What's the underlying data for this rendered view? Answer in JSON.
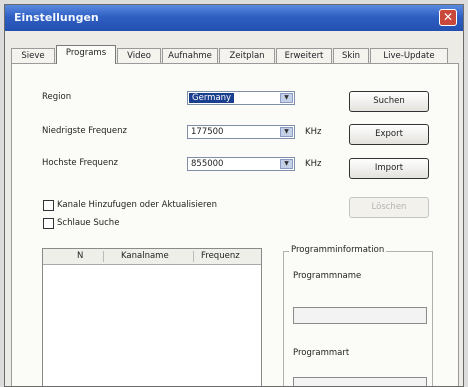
{
  "window": {
    "title": "Einstellungen"
  },
  "tabs": [
    "Sieve",
    "Programs",
    "Video",
    "Aufnahme",
    "Zeitplan",
    "Erweitert",
    "Skin",
    "Live-Update"
  ],
  "active_tab": 1,
  "form": {
    "region_label": "Region",
    "region_value": "Germany",
    "min_freq_label": "Niedrigste Frequenz",
    "min_freq_value": "177500",
    "min_freq_unit": "KHz",
    "max_freq_label": "Hochste Frequenz",
    "max_freq_value": "855000",
    "max_freq_unit": "KHz"
  },
  "buttons": {
    "search": "Suchen",
    "export": "Export",
    "import": "Import",
    "delete": "Löschen"
  },
  "checkboxes": [
    {
      "label": "Kanale Hinzufugen oder Aktualisieren",
      "checked": false
    },
    {
      "label": "Schlaue Suche",
      "checked": false
    }
  ],
  "channel_list": {
    "columns": [
      "N",
      "Kanalname",
      "Frequenz"
    ]
  },
  "program_info": {
    "title": "Programminformation",
    "name_label": "Programmname",
    "type_label": "Programmart"
  }
}
